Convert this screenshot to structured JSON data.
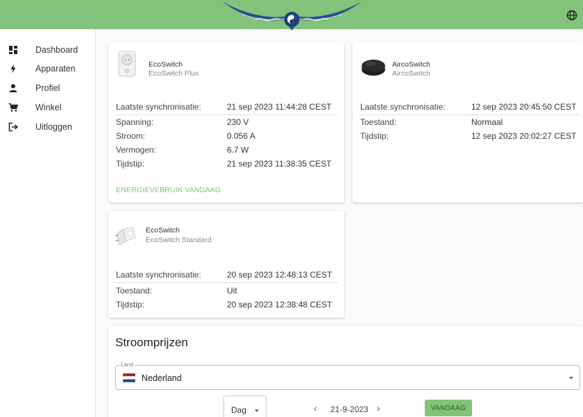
{
  "header": {
    "logo_icon": "winged-emblem-logo-icon",
    "globe_icon": "globe-icon",
    "bg_color": "#83c27b"
  },
  "sidebar": {
    "items": [
      {
        "label": "Dashboard",
        "icon": "dashboard-icon"
      },
      {
        "label": "Apparaten",
        "icon": "lightning-icon"
      },
      {
        "label": "Profiel",
        "icon": "person-icon"
      },
      {
        "label": "Winkel",
        "icon": "cart-icon"
      },
      {
        "label": "Uitloggen",
        "icon": "logout-icon"
      }
    ]
  },
  "cards": [
    {
      "name": "EcoSwitch",
      "model": "EcoSwitch Plus",
      "icon": "smart-plug-icon",
      "sync_label": "Laatste synchronisatie:",
      "sync_value": "21 sep 2023 11:44:28 CEST",
      "rows": [
        {
          "label": "Spanning:",
          "value": "230 V"
        },
        {
          "label": "Stroom:",
          "value": "0.056 A"
        },
        {
          "label": "Vermogen:",
          "value": "6.7 W"
        },
        {
          "label": "Tijdstip:",
          "value": "21 sep 2023 11:38:35 CEST"
        }
      ],
      "action": "ENERGIEVEBRUIK VANDAAG"
    },
    {
      "name": "AircoSwitch",
      "model": "AircoSwitch",
      "icon": "ir-puck-icon",
      "sync_label": "Laatste synchronisatie:",
      "sync_value": "12 sep 2023 20:45:50 CEST",
      "rows": [
        {
          "label": "Toestand:",
          "value": "Normaal"
        },
        {
          "label": "Tijdstip:",
          "value": "12 sep 2023 20:02:27 CEST"
        }
      ]
    },
    {
      "name": "EcoSwitch",
      "model": "EcoSwitch Standard",
      "icon": "plug-adapter-icon",
      "sync_label": "Laatste synchronisatie:",
      "sync_value": "20 sep 2023 12:48:13 CEST",
      "rows": [
        {
          "label": "Toestand:",
          "value": "Uit"
        },
        {
          "label": "Tijdstip:",
          "value": "20 sep 2023 12:38:48 CEST"
        }
      ]
    }
  ],
  "prices": {
    "title": "Stroomprijzen",
    "land_label": "Land",
    "land_value": "Nederland",
    "flag_icon": "netherlands-flag-icon",
    "period": "Dag",
    "date": "21-9-2023",
    "prev": "‹",
    "next": "›",
    "today_label": "VANDAAG"
  }
}
